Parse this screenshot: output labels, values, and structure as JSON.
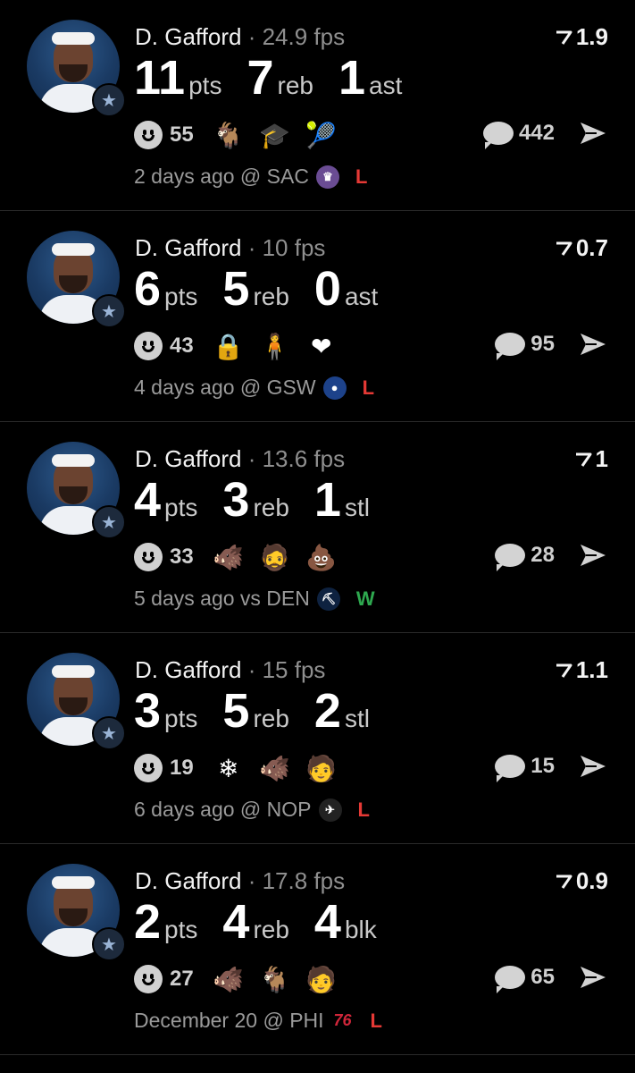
{
  "posts": [
    {
      "player": "D. Gafford",
      "fps": "24.9 fps",
      "rating": "1.9",
      "stats": [
        {
          "num": "11",
          "lbl": "pts"
        },
        {
          "num": "7",
          "lbl": "reb"
        },
        {
          "num": "1",
          "lbl": "ast"
        }
      ],
      "likes": "55",
      "emojis": [
        {
          "icon": "goat-icon",
          "glyph": "🐐"
        },
        {
          "icon": "graduation-cap-icon",
          "glyph": "🎓"
        },
        {
          "icon": "tennis-ball-icon",
          "glyph": "🎾"
        }
      ],
      "comments": "442",
      "footer": "2 days ago @ SAC",
      "opponent": {
        "icon": "kings-logo-icon",
        "color": "#6a4c93",
        "text": "♛"
      },
      "result": "L",
      "result_color": "#e53935"
    },
    {
      "player": "D. Gafford",
      "fps": "10 fps",
      "rating": "0.7",
      "stats": [
        {
          "num": "6",
          "lbl": "pts"
        },
        {
          "num": "5",
          "lbl": "reb"
        },
        {
          "num": "0",
          "lbl": "ast"
        }
      ],
      "likes": "43",
      "emojis": [
        {
          "icon": "lock-icon",
          "glyph": "🔒"
        },
        {
          "icon": "player-sticker-icon",
          "glyph": "🧍"
        },
        {
          "icon": "heart-icon",
          "glyph": "❤"
        }
      ],
      "comments": "95",
      "footer": "4 days ago @ GSW",
      "opponent": {
        "icon": "warriors-logo-icon",
        "color": "#1d428a",
        "text": "●"
      },
      "result": "L",
      "result_color": "#e53935"
    },
    {
      "player": "D. Gafford",
      "fps": "13.6 fps",
      "rating": "1",
      "stats": [
        {
          "num": "4",
          "lbl": "pts"
        },
        {
          "num": "3",
          "lbl": "reb"
        },
        {
          "num": "1",
          "lbl": "stl"
        }
      ],
      "likes": "33",
      "emojis": [
        {
          "icon": "boar-icon",
          "glyph": "🐗"
        },
        {
          "icon": "person-sticker-icon",
          "glyph": "🧔"
        },
        {
          "icon": "poop-icon",
          "glyph": "💩"
        }
      ],
      "comments": "28",
      "footer": "5 days ago vs DEN",
      "opponent": {
        "icon": "nuggets-logo-icon",
        "color": "#0e2240",
        "text": "⛏"
      },
      "result": "W",
      "result_color": "#2ea84f"
    },
    {
      "player": "D. Gafford",
      "fps": "15 fps",
      "rating": "1.1",
      "stats": [
        {
          "num": "3",
          "lbl": "pts"
        },
        {
          "num": "5",
          "lbl": "reb"
        },
        {
          "num": "2",
          "lbl": "stl"
        }
      ],
      "likes": "19",
      "emojis": [
        {
          "icon": "snowflake-icon",
          "glyph": "❄"
        },
        {
          "icon": "boar-icon",
          "glyph": "🐗"
        },
        {
          "icon": "person-sticker-icon",
          "glyph": "🧑"
        }
      ],
      "comments": "15",
      "footer": "6 days ago @ NOP",
      "opponent": {
        "icon": "pelicans-logo-icon",
        "color": "#222",
        "text": "✈"
      },
      "result": "L",
      "result_color": "#e53935"
    },
    {
      "player": "D. Gafford",
      "fps": "17.8 fps",
      "rating": "0.9",
      "stats": [
        {
          "num": "2",
          "lbl": "pts"
        },
        {
          "num": "4",
          "lbl": "reb"
        },
        {
          "num": "4",
          "lbl": "blk"
        }
      ],
      "likes": "27",
      "emojis": [
        {
          "icon": "boar-icon",
          "glyph": "🐗"
        },
        {
          "icon": "goat-icon",
          "glyph": "🐐"
        },
        {
          "icon": "person-sticker-icon",
          "glyph": "🧑"
        }
      ],
      "comments": "65",
      "footer": "December 20 @ PHI",
      "opponent": {
        "icon": "76ers-logo-icon",
        "color": "transparent",
        "text": "76"
      },
      "result": "L",
      "result_color": "#e53935"
    }
  ]
}
